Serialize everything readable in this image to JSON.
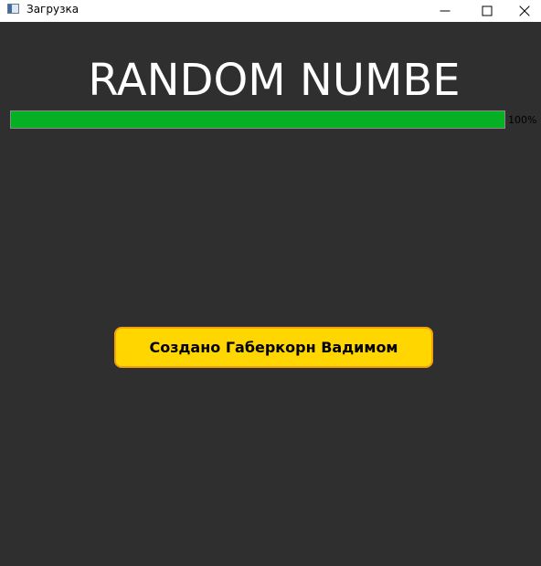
{
  "window": {
    "title": "Загрузка",
    "icon": "app-window-icon",
    "controls": [
      "minimize-icon",
      "maximize-icon",
      "close-icon"
    ]
  },
  "main": {
    "heading": "RANDOM NUMBE",
    "progress": {
      "value": 100,
      "label": "100%",
      "fill_color": "#06b025"
    },
    "credit_button": {
      "label": "Создано Габеркорн Вадимом",
      "background_color": "#ffd600",
      "border_color": "#f2a20c"
    },
    "background_color": "#2f2f2f"
  }
}
